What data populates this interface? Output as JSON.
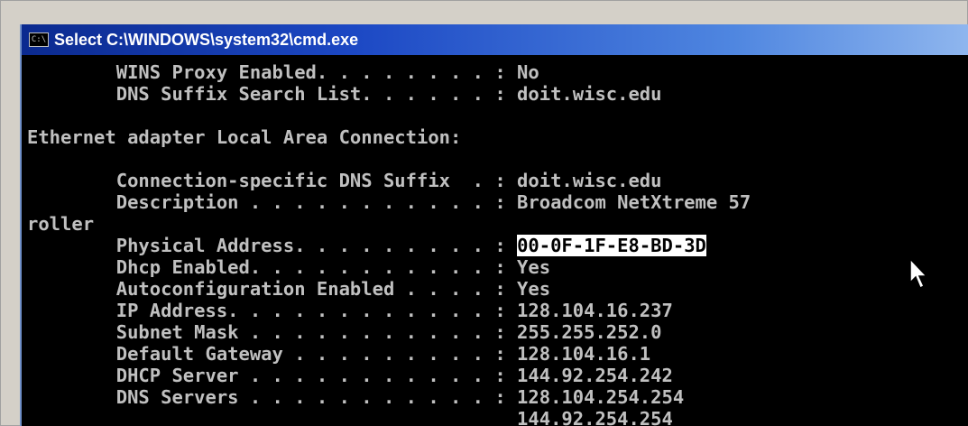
{
  "window": {
    "title": "Select C:\\WINDOWS\\system32\\cmd.exe",
    "icon": "cmd-icon",
    "icon_text": "C:\\"
  },
  "console": {
    "lines": [
      "        WINS Proxy Enabled. . . . . . . . : No",
      "        DNS Suffix Search List. . . . . . : doit.wisc.edu",
      "",
      "Ethernet adapter Local Area Connection:",
      "",
      "        Connection-specific DNS Suffix  . : doit.wisc.edu",
      "        Description . . . . . . . . . . . : Broadcom NetXtreme 57",
      "roller",
      "        Physical Address. . . . . . . . . : ",
      "        Dhcp Enabled. . . . . . . . . . . : Yes",
      "        Autoconfiguration Enabled . . . . : Yes",
      "        IP Address. . . . . . . . . . . . : 128.104.16.237",
      "        Subnet Mask . . . . . . . . . . . : 255.255.252.0",
      "        Default Gateway . . . . . . . . . : 128.104.16.1",
      "        DHCP Server . . . . . . . . . . . : 144.92.254.242",
      "        DNS Servers . . . . . . . . . . . : 128.104.254.254",
      "                                            144.92.254.254"
    ],
    "selected_text": "00-0F-1F-E8-BD-3D"
  },
  "colors": {
    "console_bg": "#000000",
    "console_fg": "#c0c0c0",
    "selection_bg": "#ffffff",
    "title_gradient_start": "#0b2a8f",
    "title_gradient_end": "#8fb6ee"
  },
  "icons": {
    "pointer": "mouse-pointer-icon"
  }
}
